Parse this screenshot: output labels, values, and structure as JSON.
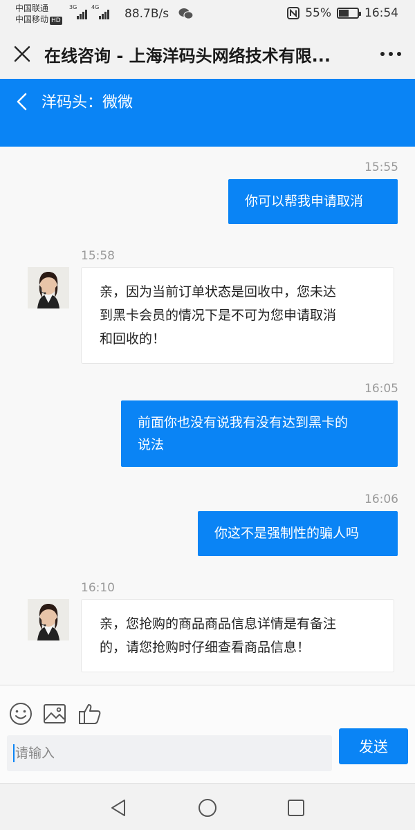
{
  "status_bar": {
    "carrier_1": "中国联通",
    "carrier_2": "中国移动",
    "hd_badge": "HD",
    "net_1": "3G",
    "net_2": "4G",
    "speed": "88.7B/s",
    "battery_percent": "55%",
    "battery_level": 0.55,
    "time": "16:54"
  },
  "browser": {
    "title": "在线咨询 - 上海洋码头网络技术有限..."
  },
  "chat_header": {
    "agent_label": "洋码头：微微"
  },
  "messages": [
    {
      "direction": "out",
      "time": "15:55",
      "lines": [
        "你可以帮我申请取消"
      ]
    },
    {
      "direction": "in",
      "time": "15:58",
      "lines": [
        "亲，因为当前订单状态是回收中，您未达",
        "到黑卡会员的情况下是不可为您申请取消",
        "和回收的！"
      ]
    },
    {
      "direction": "out",
      "time": "16:05",
      "lines": [
        "前面你也没有说我有没有达到黑卡的",
        "说法"
      ]
    },
    {
      "direction": "out",
      "time": "16:06",
      "lines": [
        "你这不是强制性的骗人吗"
      ]
    },
    {
      "direction": "in",
      "time": "16:10",
      "lines": [
        "亲，您抢购的商品商品信息详情是有备注",
        "的，请您抢购时仔细查看商品信息！"
      ]
    }
  ],
  "composer": {
    "placeholder": "请输入",
    "send_label": "发送"
  },
  "colors": {
    "accent": "#0a84f5",
    "background": "#f8f8f8"
  },
  "icons": [
    "close-icon",
    "more-icon",
    "back-icon",
    "emoji-icon",
    "image-icon",
    "thumbs-up-icon",
    "nav-back-icon",
    "nav-home-icon",
    "nav-recents-icon"
  ]
}
